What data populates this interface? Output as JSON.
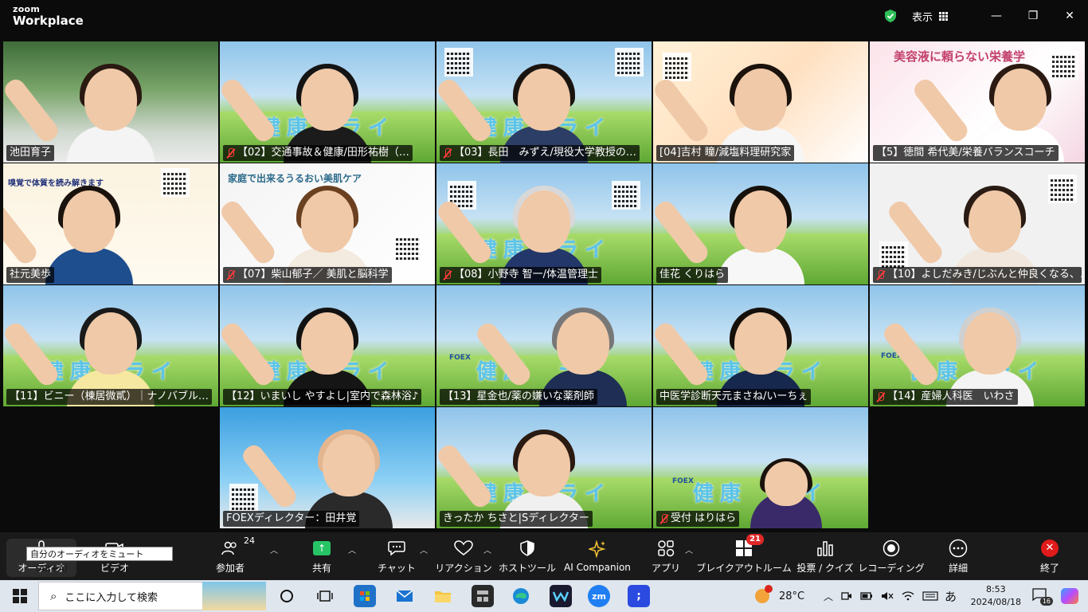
{
  "app": {
    "brand_top": "zoom",
    "brand_bottom": "Workplace",
    "view_label": "表示"
  },
  "window": {
    "minimize": "—",
    "restore": "❐",
    "close": "✕"
  },
  "tiles": [
    {
      "name": "池田育子",
      "muted": false
    },
    {
      "name": "【02】交通事故＆健康/田形祐樹（…",
      "muted": true
    },
    {
      "name": "【03】長田　みずえ/現役大学教授の…",
      "muted": true
    },
    {
      "name": "[04]吉村 瞳/減塩料理研究家",
      "muted": false
    },
    {
      "name": "【5】徳間 希代美/栄養バランスコーチ",
      "muted": false
    },
    {
      "name": "社元美歩",
      "muted": false
    },
    {
      "name": "【07】柴山郁子／ 美肌と脳科学",
      "muted": true
    },
    {
      "name": "【08】小野寺 智一/体温管理士",
      "muted": true
    },
    {
      "name": "佳花 くりはら",
      "muted": false
    },
    {
      "name": "【10】よしだみき/じぶんと仲良くなる、…",
      "muted": true
    },
    {
      "name": "【11】ビニー（棟居微貳）｜ナノバブル…",
      "muted": false
    },
    {
      "name": "【12】いまいし やすよし|室内で森林浴♪",
      "muted": false
    },
    {
      "name": "【13】星金也/薬の嫌いな薬剤師",
      "muted": false
    },
    {
      "name": "中医学診断天元まさね/いーちぇ",
      "muted": false
    },
    {
      "name": "【14】産婦人科医　いわさ",
      "muted": true
    },
    {
      "name": "FOEXディレクター：田井覚",
      "muted": false
    },
    {
      "name": "きったか ちさと|Sディレクター",
      "muted": false
    },
    {
      "name": "受付 はりはら",
      "muted": true
    }
  ],
  "slides": {
    "banner": "健康　ライ",
    "foex": "FOEX",
    "promo_07": "家庭で出来るうるおい美肌ケア",
    "promo_05": "美容液に頼らない栄養学",
    "promo_06": "嗅覚で体質を読み解きます"
  },
  "toolbar": {
    "audio": "オーディオ",
    "audio_tooltip": "自分のオーディオをミュート（Alt+A）",
    "video": "ビデオ",
    "participants": "参加者",
    "participants_count": "24",
    "share": "共有",
    "chat": "チャット",
    "reactions": "リアクション",
    "host_tools": "ホストツール",
    "ai_companion": "AI Companion",
    "apps": "アプリ",
    "breakout": "ブレイクアウトルーム",
    "breakout_badge": "21",
    "polls": "投票 / クイズ",
    "recording": "レコーディング",
    "more": "詳細",
    "end": "終了"
  },
  "taskbar": {
    "search_placeholder": "ここに入力して検索",
    "weather": "28°C",
    "ime": "あ",
    "time": "8:53",
    "date": "2024/08/18",
    "notifications": "16"
  },
  "colors": {
    "accent_green": "#27c466",
    "end_red": "#e01b1b",
    "mute_red": "#ff3b3b"
  }
}
